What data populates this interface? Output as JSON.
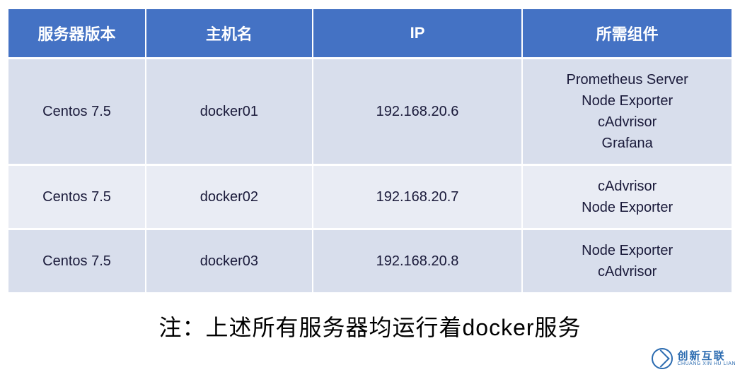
{
  "table": {
    "headers": [
      "服务器版本",
      "主机名",
      "IP",
      "所需组件"
    ],
    "rows": [
      {
        "version": "Centos 7.5",
        "hostname": "docker01",
        "ip": "192.168.20.6",
        "components": "Prometheus  Server\nNode  Exporter\ncAdvrisor\nGrafana"
      },
      {
        "version": "Centos 7.5",
        "hostname": "docker02",
        "ip": "192.168.20.7",
        "components": "cAdvrisor\nNode  Exporter"
      },
      {
        "version": "Centos 7.5",
        "hostname": "docker03",
        "ip": "192.168.20.8",
        "components": "Node  Exporter\ncAdvrisor"
      }
    ]
  },
  "note": "注：上述所有服务器均运行着docker服务",
  "watermark": {
    "cn": "创新互联",
    "en": "CHUANG XIN HU LIAN"
  },
  "chart_data": {
    "type": "table",
    "title": "",
    "columns": [
      "服务器版本",
      "主机名",
      "IP",
      "所需组件"
    ],
    "rows": [
      [
        "Centos 7.5",
        "docker01",
        "192.168.20.6",
        "Prometheus Server; Node Exporter; cAdvrisor; Grafana"
      ],
      [
        "Centos 7.5",
        "docker02",
        "192.168.20.7",
        "cAdvrisor; Node Exporter"
      ],
      [
        "Centos 7.5",
        "docker03",
        "192.168.20.8",
        "Node Exporter; cAdvrisor"
      ]
    ],
    "footer": "注：上述所有服务器均运行着docker服务"
  }
}
